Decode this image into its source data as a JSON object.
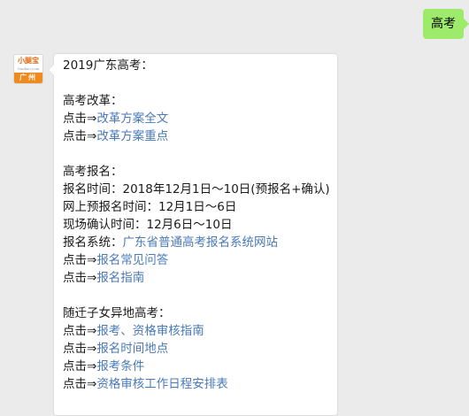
{
  "outgoing": {
    "text": "高考"
  },
  "avatar": {
    "brand": "小腿宝",
    "brand_sub": "Gaokao.com",
    "city": "广州"
  },
  "message": {
    "lines": [
      {
        "text": "2019广东高考："
      },
      {
        "text": ""
      },
      {
        "text": "高考改革："
      },
      {
        "prefix": "点击⇒",
        "link": "改革方案全文"
      },
      {
        "prefix": "点击⇒",
        "link": "改革方案重点"
      },
      {
        "text": ""
      },
      {
        "text": "高考报名："
      },
      {
        "text": "报名时间：2018年12月1日～10日(预报名+确认)"
      },
      {
        "text": "网上预报名时间：12月1日～6日"
      },
      {
        "text": "现场确认时间：12月6日～10日"
      },
      {
        "prefix": "报名系统：",
        "link": "广东省普通高考报名系统网站"
      },
      {
        "prefix": "点击⇒",
        "link": "报名常见问答"
      },
      {
        "prefix": "点击⇒",
        "link": "报名指南"
      },
      {
        "text": ""
      },
      {
        "text": "随迁子女异地高考："
      },
      {
        "prefix": "点击⇒",
        "link": "报考、资格审核指南"
      },
      {
        "prefix": "点击⇒",
        "link": "报名时间地点"
      },
      {
        "prefix": "点击⇒",
        "link": "报考条件"
      },
      {
        "prefix": "点击⇒",
        "link": "资格审核工作日程安排表"
      }
    ]
  },
  "colors": {
    "link": "#4a79b8",
    "outgoing_bubble": "#9eea6a",
    "background": "#ebebeb"
  }
}
